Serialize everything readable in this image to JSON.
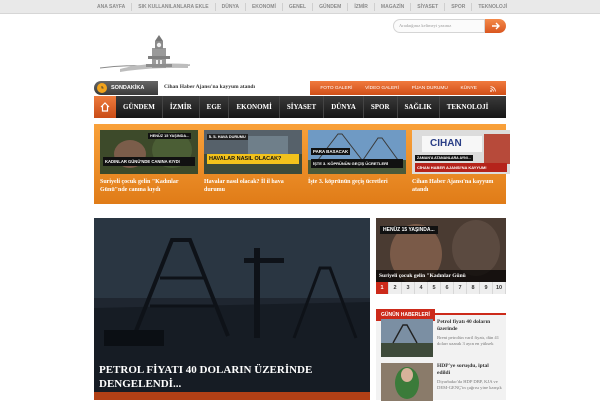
{
  "top_nav": [
    {
      "label": "ANA SAYFA"
    },
    {
      "label": "SIK KULLANILANLARA EKLE"
    },
    {
      "label": "DÜNYA"
    },
    {
      "label": "EKONOMİ"
    },
    {
      "label": "GENEL"
    },
    {
      "label": "GÜNDEM"
    },
    {
      "label": "İZMİR"
    },
    {
      "label": "MAGAZİN"
    },
    {
      "label": "SİYASET"
    },
    {
      "label": "SPOR"
    },
    {
      "label": "TEKNOLOJİ"
    }
  ],
  "search": {
    "placeholder": "Aradaığınız kelimeyi yazınız"
  },
  "breaking": {
    "label": "SONDAKİKA",
    "headline": "Cihan Haber Ajansı'na kayyum atandı"
  },
  "quick_links": [
    {
      "label": "FOTO GALERİ"
    },
    {
      "label": "VİDEO GALERİ"
    },
    {
      "label": "PİJAN DURUMU"
    },
    {
      "label": "KÜNYE"
    }
  ],
  "main_nav": [
    {
      "label": "GÜNDEM"
    },
    {
      "label": "İZMİR"
    },
    {
      "label": "EGE"
    },
    {
      "label": "EKONOMİ"
    },
    {
      "label": "SİYASET"
    },
    {
      "label": "DÜNYA"
    },
    {
      "label": "SPOR"
    },
    {
      "label": "SAĞLIK"
    },
    {
      "label": "TEKNOLOJİ"
    }
  ],
  "featured": [
    {
      "title": "Suriyeli çocuk gelin \"Kadınlar Günü\"nde canına kıydı",
      "thumb_text": "KADINLAR GÜNÜ'NDE CANINA KIYDI",
      "thumb_tag": "HENÜZ 15 YAŞINDA..."
    },
    {
      "title": "Havalar nasıl olacak? İl il hava durumu",
      "thumb_text": "HAVALAR NASIL OLACAK?",
      "thumb_tag": "İL İL HAVA DURUMU"
    },
    {
      "title": "İşte 3. köprünün geçiş ücretleri",
      "thumb_text": "İŞTE 3. KÖPRÜNÜN GEÇİŞ ÜCRETLERİ",
      "thumb_tag": "PARA BASACAK"
    },
    {
      "title": "Cihan Haber Ajansı'na kayyum atandı",
      "thumb_text": "CİHAN HABER AJANSI'NA KAYYUM!",
      "thumb_tag": "ZAMAN'A ATANANLARA AYNI..."
    }
  ],
  "hero": {
    "title": "PETROL FİYATI 40 DOLARIN ÜZERİNDE DENGELENDİ..."
  },
  "side_slider": {
    "caption": "Suriyeli çocuk gelin \"Kadınlar Günü",
    "tag": "HENÜZ 15 YAŞINDA...",
    "pages": [
      "1",
      "2",
      "3",
      "4",
      "5",
      "6",
      "7",
      "8",
      "9",
      "10"
    ]
  },
  "news_box": {
    "title": "GÜNÜN HABERLERİ",
    "items": [
      {
        "title": "Petrol fiyatı 40 doların üzerinde",
        "summary": "Brent petrolün varil fiyatı, dün 41 dolarr uzarak 3 ayın en yüksek"
      },
      {
        "title": "HDP'ye soruşdu, iptal edildi",
        "summary": "Diyarbakır'da HDP DBP, KJA ve DEM-GENÇ'in çağrısı yine karışık"
      }
    ]
  },
  "colors": {
    "accent": "#e07c18",
    "nav_dark": "#1f1f1f",
    "brand_red": "#cc2a1a"
  }
}
